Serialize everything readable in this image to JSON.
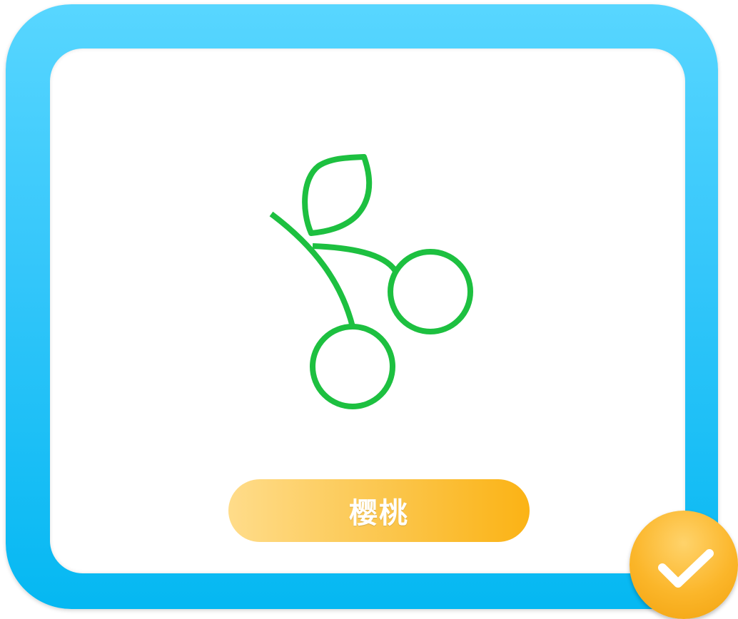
{
  "card": {
    "label": "樱桃",
    "icon": "cherry-icon",
    "selected": true,
    "selected_icon": "checkmark-icon"
  },
  "colors": {
    "frame": "#1ec0f6",
    "icon_stroke": "#1dc040",
    "label_bg_start": "#ffdc8a",
    "label_bg_end": "#fbb315",
    "badge": "#fbb62a"
  }
}
